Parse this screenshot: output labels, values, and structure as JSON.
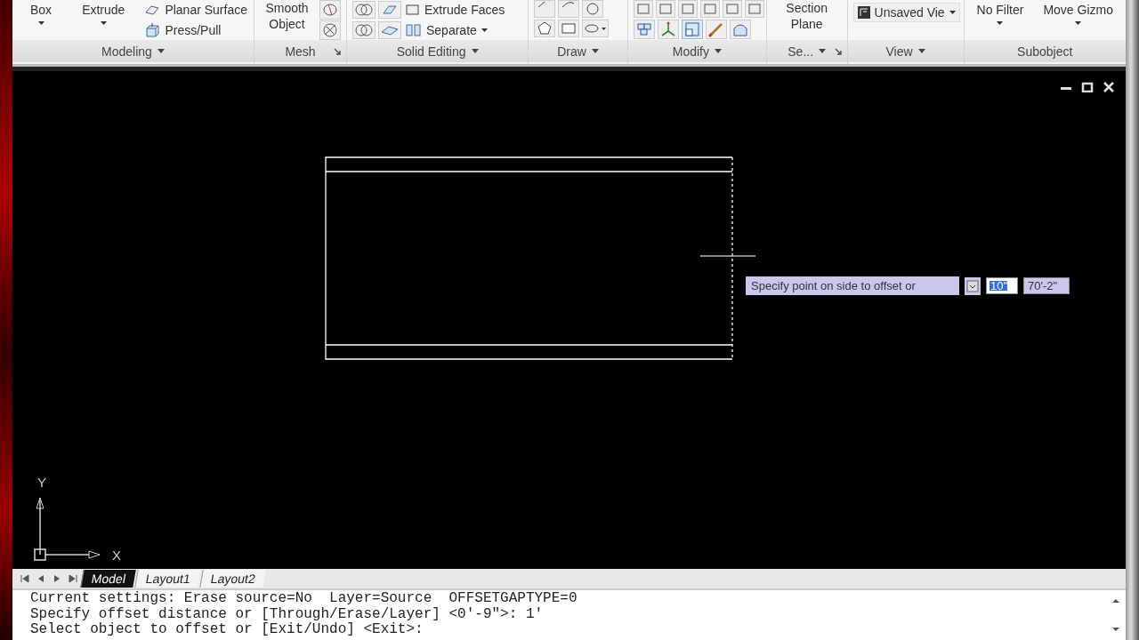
{
  "ribbon": {
    "panels": [
      {
        "kind": "modeling",
        "title": "Modeling",
        "menu": true,
        "launcher": false,
        "buttons": [
          {
            "label": "Box",
            "caret": true
          },
          {
            "label": "Extrude",
            "caret": true
          },
          {
            "label": "Planar Surface",
            "caret": false
          },
          {
            "label": "Press/Pull",
            "caret": false
          }
        ]
      },
      {
        "kind": "mesh",
        "title": "Mesh",
        "menu": false,
        "launcher": true,
        "buttons": [
          {
            "label": "Smooth Object",
            "caret": false
          }
        ]
      },
      {
        "kind": "solid",
        "title": "Solid Editing",
        "menu": true,
        "launcher": false,
        "buttons": [
          {
            "label": "Extrude Faces",
            "caret": false
          },
          {
            "label": "Separate",
            "caret": true
          }
        ]
      },
      {
        "kind": "draw",
        "title": "Draw",
        "menu": true,
        "launcher": false
      },
      {
        "kind": "modify",
        "title": "Modify",
        "menu": true,
        "launcher": false
      },
      {
        "kind": "section",
        "title": "Se...",
        "menu": true,
        "launcher": true,
        "buttons": [
          {
            "label": "Section Plane",
            "caret": false
          }
        ]
      },
      {
        "kind": "view",
        "title": "View",
        "menu": true,
        "launcher": false,
        "buttons": [
          {
            "label": "Unsaved Vie",
            "caret": true
          }
        ]
      },
      {
        "kind": "subobject",
        "title": "Subobject",
        "menu": false,
        "launcher": false,
        "buttons": [
          {
            "label": "No Filter",
            "caret": true
          },
          {
            "label": "Move Gizmo",
            "caret": true
          }
        ]
      }
    ]
  },
  "dynamic_input": {
    "prompt": "Specify point on side to offset or",
    "fields": [
      {
        "value": "10\"",
        "selected": true
      },
      {
        "value": "70'-2\"",
        "selected": false
      }
    ]
  },
  "ucs": {
    "x_label": "X",
    "y_label": "Y"
  },
  "tabs": [
    {
      "label": "Model",
      "selected": true
    },
    {
      "label": "Layout1",
      "selected": false
    },
    {
      "label": "Layout2",
      "selected": false
    }
  ],
  "command_lines": [
    "Current settings: Erase source=No  Layer=Source  OFFSETGAPTYPE=0",
    "Specify offset distance or [Through/Erase/Layer] <0'-9\">: 1'",
    "Select object to offset or [Exit/Undo] <Exit>:"
  ]
}
